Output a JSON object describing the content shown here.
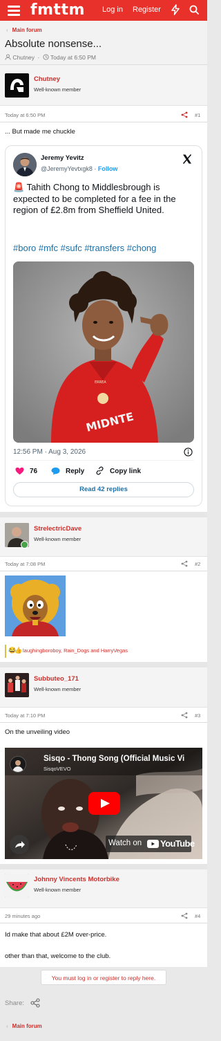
{
  "header": {
    "logo": "fmttm",
    "login": "Log in",
    "register": "Register"
  },
  "breadcrumb": {
    "label": "Main forum"
  },
  "thread": {
    "title": "Absolute nonsense...",
    "author": "Chutney",
    "date": "Today at 6:50 PM"
  },
  "posts": [
    {
      "user": "Chutney",
      "role": "Well-known member",
      "time": "Today at 6:50 PM",
      "number": "#1",
      "text": "... But made me chuckle",
      "tweet": {
        "name": "Jeremy Yevitz",
        "handle": "@JeremyYevtxgk8",
        "follow": "Follow",
        "body": "🚨 Tahith Chong to Middlesbrough is expected to be completed for a fee in the region of £2.8m from Sheffield United.",
        "hashtags": "#boro #mfc #sufc #transfers #chong",
        "shirt_text": "MIDNTE",
        "timestamp": "12:56 PM · Aug 3, 2026",
        "likes": "76",
        "reply": "Reply",
        "copy_link": "Copy link",
        "read_replies": "Read 42 replies"
      }
    },
    {
      "user": "StrelectricDave",
      "role": "Well-known member",
      "time": "Today at 7:08 PM",
      "number": "#2",
      "reactions": "laughingboroboy, Rain_Dogs and HarryVegas"
    },
    {
      "user": "Subbuteo_171",
      "role": "Well-known member",
      "time": "Today at 7:10 PM",
      "number": "#3",
      "text": "On the unveiling video",
      "video": {
        "title": "Sisqo - Thong Song (Official Music Vi",
        "channel": "SisqoVEVO",
        "watch_on": "Watch on",
        "brand": "YouTube"
      }
    },
    {
      "user": "Johnny Vincents Motorbike",
      "role": "Well-known member",
      "time": "29 minutes ago",
      "number": "#4",
      "text1": "Id make that about £2M over-price.",
      "text2": "other than that, welcome to the club."
    }
  ],
  "footer": {
    "login_prompt": "You must log in or register to reply here.",
    "share": "Share:",
    "breadcrumb": "Main forum"
  },
  "colors": {
    "brand": "#e8312b",
    "link": "#c9302c",
    "twitter_blue": "#1d9bf0",
    "like": "#f91880"
  }
}
